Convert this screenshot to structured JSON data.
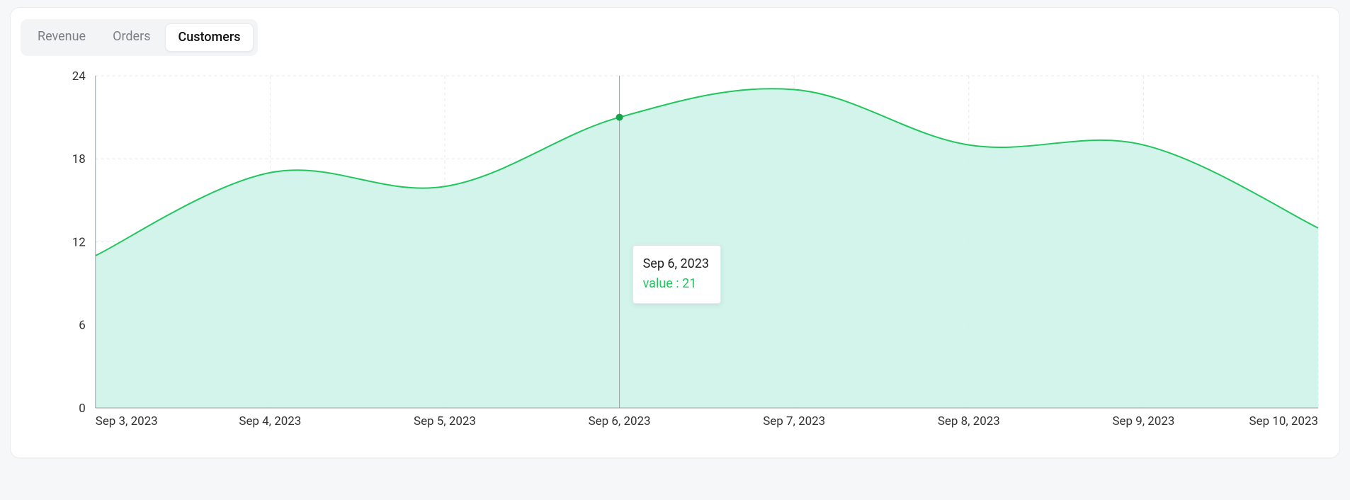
{
  "tabs": [
    {
      "id": "revenue",
      "label": "Revenue",
      "active": false
    },
    {
      "id": "orders",
      "label": "Orders",
      "active": false
    },
    {
      "id": "customers",
      "label": "Customers",
      "active": true
    }
  ],
  "chart_data": {
    "type": "area",
    "categories": [
      "Sep 3, 2023",
      "Sep 4, 2023",
      "Sep 5, 2023",
      "Sep 6, 2023",
      "Sep 7, 2023",
      "Sep 8, 2023",
      "Sep 9, 2023",
      "Sep 10, 2023"
    ],
    "values": [
      11,
      17,
      16,
      21,
      23,
      19,
      19,
      13
    ],
    "ylim": [
      0,
      24
    ],
    "y_ticks": [
      0,
      6,
      12,
      18,
      24
    ],
    "xlabel": "",
    "ylabel": "",
    "title": "",
    "line_color": "#22c55e",
    "fill_color": "#cdf3e8",
    "hover": {
      "index": 3,
      "date": "Sep 6, 2023",
      "value_label": "value : 21"
    }
  }
}
